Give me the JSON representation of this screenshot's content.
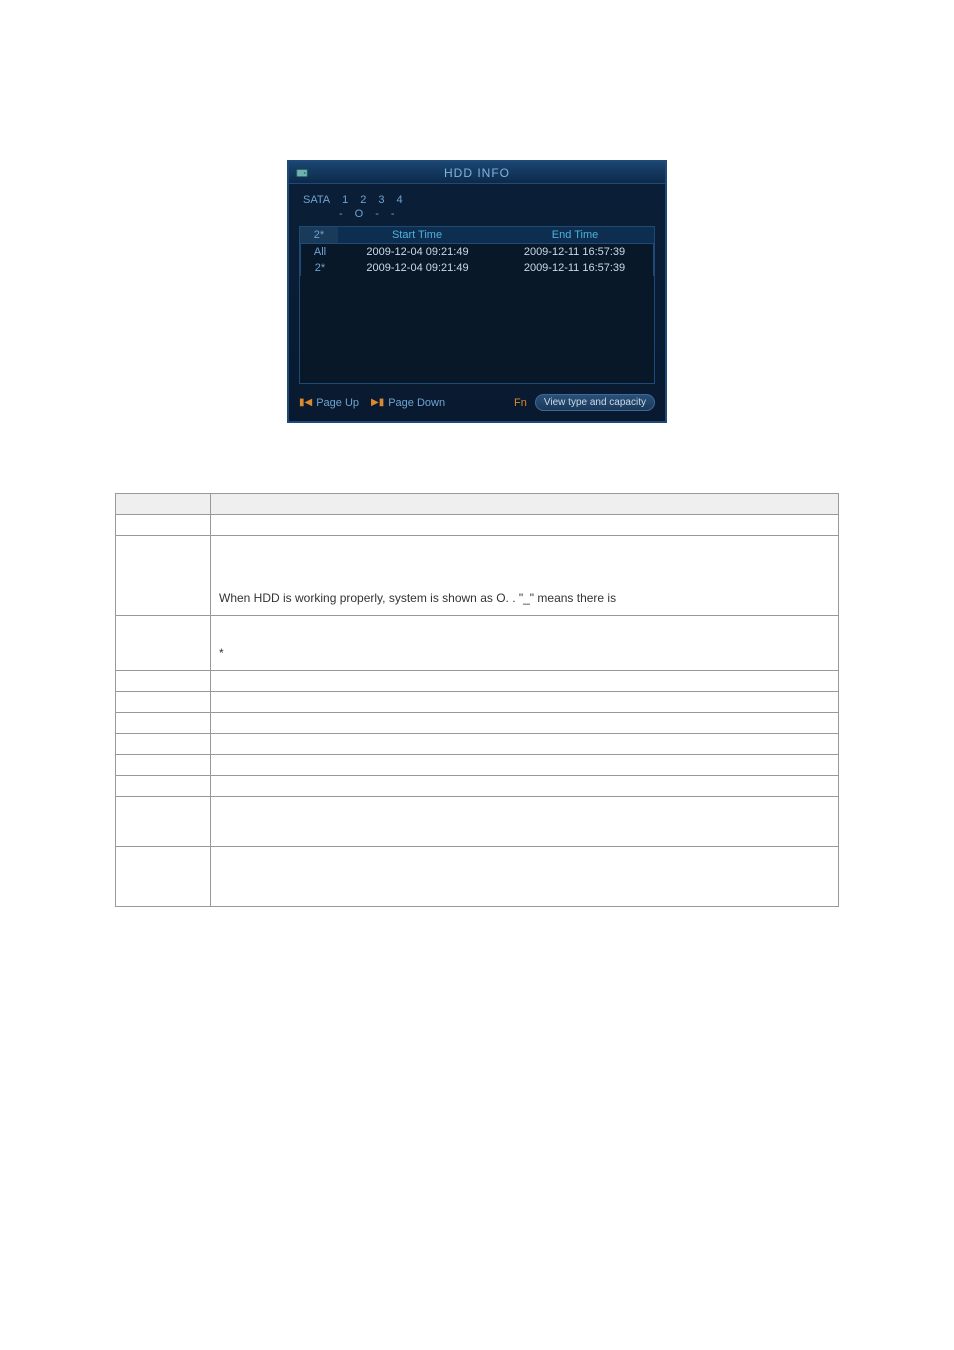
{
  "dialog": {
    "title": "HDD INFO",
    "sata_label": "SATA",
    "slots": [
      "1",
      "2",
      "3",
      "4"
    ],
    "statuses": [
      "-",
      "O",
      "-",
      "-"
    ],
    "table": {
      "head_id": "2*",
      "head_start": "Start Time",
      "head_end": "End Time",
      "rows": [
        {
          "id": "All",
          "start": "2009-12-04 09:21:49",
          "end": "2009-12-11 16:57:39"
        },
        {
          "id": "2*",
          "start": "2009-12-04 09:21:49",
          "end": "2009-12-11 16:57:39"
        }
      ]
    },
    "page_up": "Page Up",
    "page_down": "Page Down",
    "fn": "Fn",
    "view_btn": "View type and capacity"
  },
  "desc": {
    "header_param": "",
    "header_func": "",
    "rows": [
      {
        "param": "",
        "func": ""
      },
      {
        "param": "",
        "func": "When HDD is working properly, system is shown as O. . \"_\" means there is"
      },
      {
        "param": "",
        "func": "*"
      },
      {
        "param": "",
        "func": ""
      },
      {
        "param": "",
        "func": ""
      },
      {
        "param": "",
        "func": ""
      },
      {
        "param": "",
        "func": ""
      },
      {
        "param": "",
        "func": ""
      },
      {
        "param": "",
        "func": ""
      },
      {
        "param": "",
        "func": ""
      },
      {
        "param": "",
        "func": ""
      }
    ]
  }
}
